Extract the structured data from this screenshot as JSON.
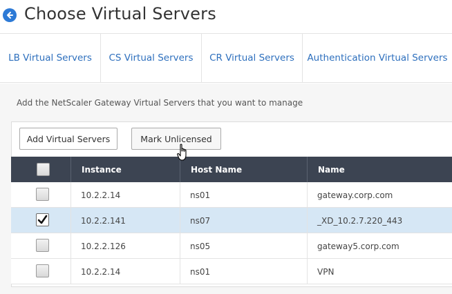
{
  "header": {
    "title": "Choose Virtual Servers",
    "back_icon": "back-arrow-icon",
    "accent_color": "#2d7ad6"
  },
  "tabs": [
    {
      "label": "LB Virtual Servers"
    },
    {
      "label": "CS Virtual Servers"
    },
    {
      "label": "CR Virtual Servers"
    },
    {
      "label": "Authentication Virtual Servers"
    }
  ],
  "instruction": "Add the NetScaler Gateway Virtual Servers that you want to manage",
  "toolbar": {
    "add_label": "Add Virtual Servers",
    "mark_label": "Mark Unlicensed"
  },
  "grid": {
    "columns": [
      "Instance",
      "Host Name",
      "Name"
    ],
    "header_color": "#3c4452",
    "rows": [
      {
        "instance": "10.2.2.14",
        "host": "ns01",
        "name": "gateway.corp.com",
        "checked": false
      },
      {
        "instance": "10.2.2.141",
        "host": "ns07",
        "name": "_XD_10.2.7.220_443",
        "checked": true
      },
      {
        "instance": "10.2.2.126",
        "host": "ns05",
        "name": "gateway5.corp.com",
        "checked": false
      },
      {
        "instance": "10.2.2.14",
        "host": "ns01",
        "name": "VPN",
        "checked": false
      }
    ]
  }
}
